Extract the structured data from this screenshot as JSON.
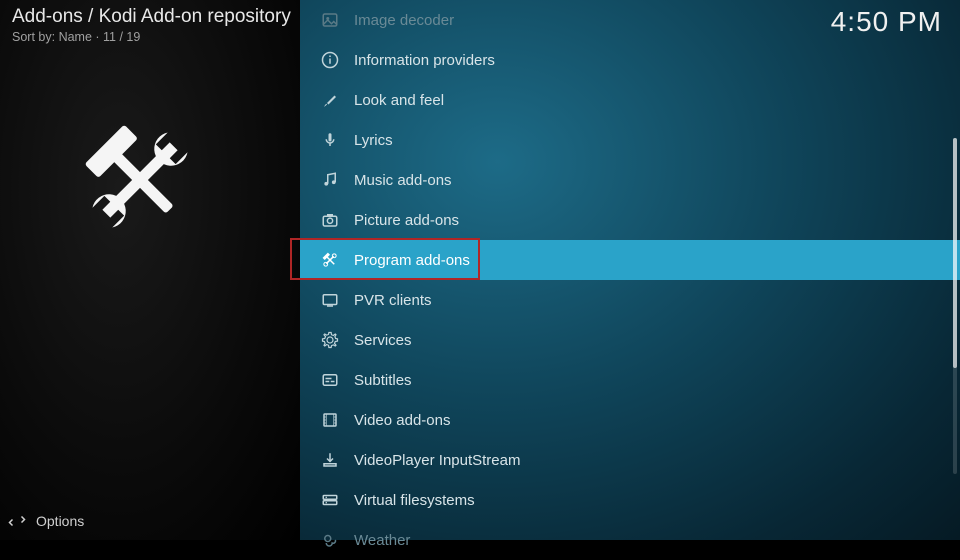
{
  "header": {
    "breadcrumb": "Add-ons / Kodi Add-on repository",
    "sort_label": "Sort by:",
    "sort_value": "Name",
    "position": "11 / 19",
    "clock": "4:50 PM"
  },
  "sidebar": {
    "icon": "tools-icon"
  },
  "list": {
    "items": [
      {
        "icon": "image-icon",
        "label": "Image decoder",
        "selected": false,
        "faded": true
      },
      {
        "icon": "info-icon",
        "label": "Information providers",
        "selected": false,
        "faded": false
      },
      {
        "icon": "brush-icon",
        "label": "Look and feel",
        "selected": false,
        "faded": false
      },
      {
        "icon": "mic-icon",
        "label": "Lyrics",
        "selected": false,
        "faded": false
      },
      {
        "icon": "music-icon",
        "label": "Music add-ons",
        "selected": false,
        "faded": false
      },
      {
        "icon": "camera-icon",
        "label": "Picture add-ons",
        "selected": false,
        "faded": false
      },
      {
        "icon": "tools-small-icon",
        "label": "Program add-ons",
        "selected": true,
        "faded": false
      },
      {
        "icon": "tv-icon",
        "label": "PVR clients",
        "selected": false,
        "faded": false
      },
      {
        "icon": "gear-icon",
        "label": "Services",
        "selected": false,
        "faded": false
      },
      {
        "icon": "subtitles-icon",
        "label": "Subtitles",
        "selected": false,
        "faded": false
      },
      {
        "icon": "film-icon",
        "label": "Video add-ons",
        "selected": false,
        "faded": false
      },
      {
        "icon": "download-icon",
        "label": "VideoPlayer InputStream",
        "selected": false,
        "faded": false
      },
      {
        "icon": "hdd-icon",
        "label": "Virtual filesystems",
        "selected": false,
        "faded": false
      },
      {
        "icon": "weather-icon",
        "label": "Weather",
        "selected": false,
        "faded": true
      }
    ]
  },
  "footer": {
    "options_label": "Options"
  }
}
